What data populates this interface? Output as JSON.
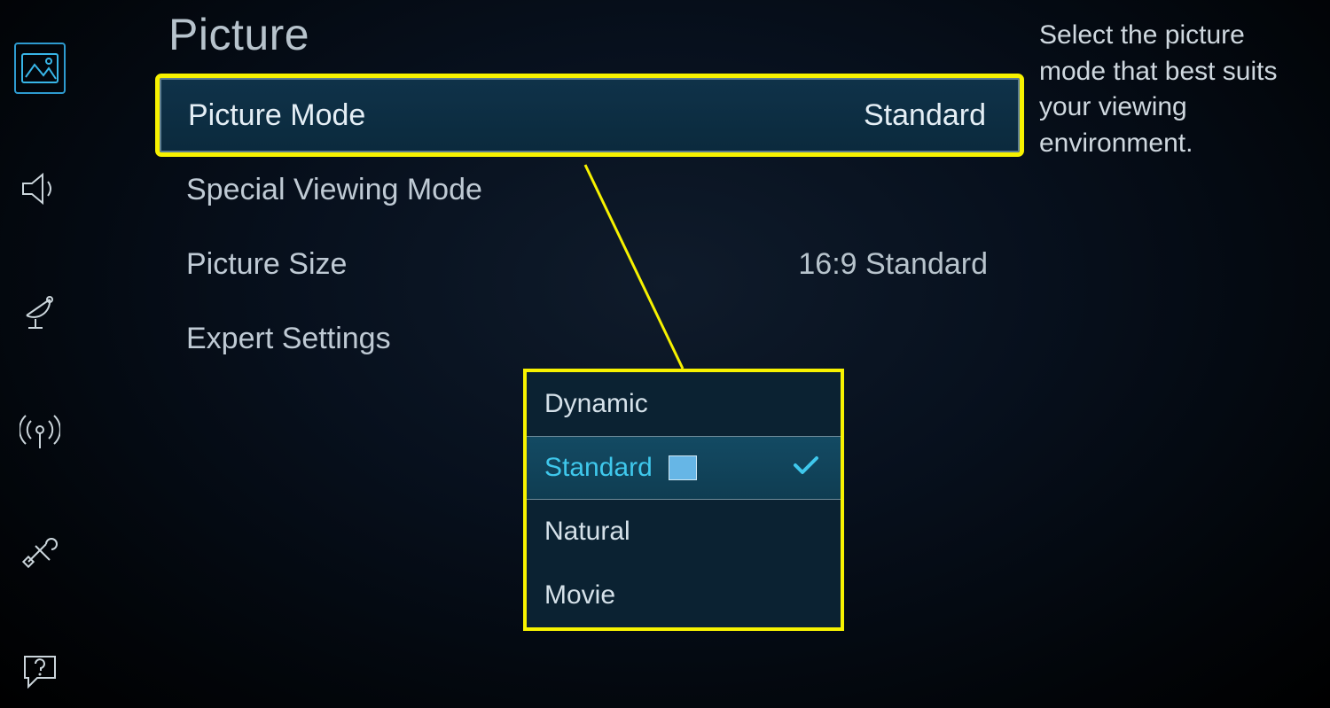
{
  "page_title": "Picture",
  "help_text": "Select the picture mode that best suits your viewing environment.",
  "sidebar": [
    {
      "name": "picture",
      "active": true
    },
    {
      "name": "sound",
      "active": false
    },
    {
      "name": "broadcast",
      "active": false
    },
    {
      "name": "network",
      "active": false
    },
    {
      "name": "system",
      "active": false
    },
    {
      "name": "support",
      "active": false
    }
  ],
  "rows": [
    {
      "label": "Picture Mode",
      "value": "Standard",
      "highlighted": true
    },
    {
      "label": "Special Viewing Mode",
      "value": "",
      "highlighted": false
    },
    {
      "label": "Picture Size",
      "value": "16:9 Standard",
      "highlighted": false
    },
    {
      "label": "Expert Settings",
      "value": "",
      "highlighted": false
    }
  ],
  "dropdown": {
    "options": [
      {
        "label": "Dynamic",
        "selected": false,
        "energy_star": false
      },
      {
        "label": "Standard",
        "selected": true,
        "energy_star": true
      },
      {
        "label": "Natural",
        "selected": false,
        "energy_star": false
      },
      {
        "label": "Movie",
        "selected": false,
        "energy_star": false
      }
    ]
  }
}
